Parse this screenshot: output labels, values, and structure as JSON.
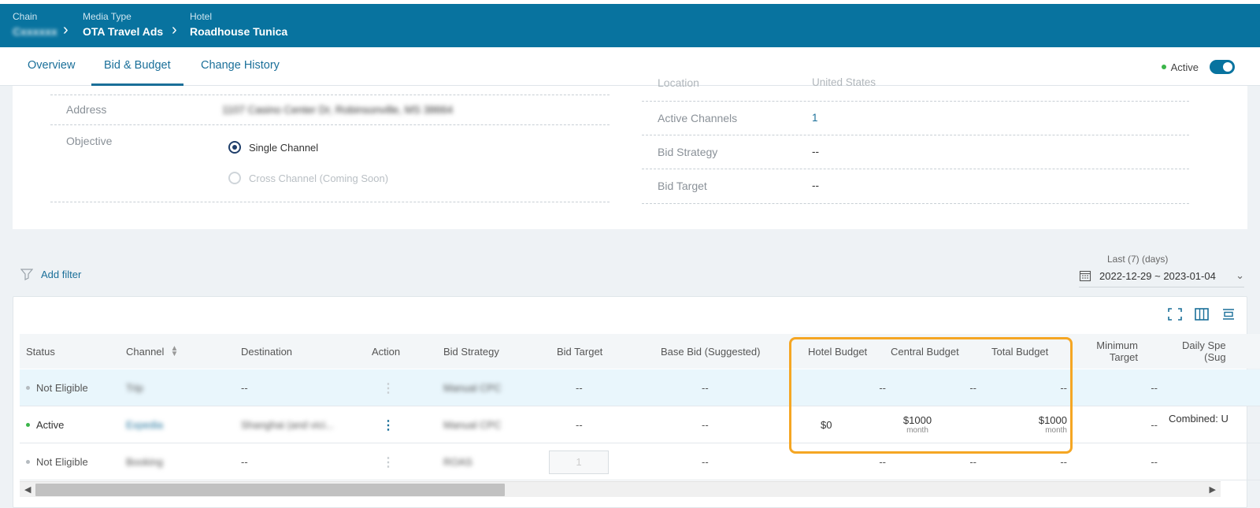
{
  "breadcrumb": {
    "chain": {
      "label": "Chain",
      "value": "Cxxxxxx"
    },
    "media_type": {
      "label": "Media Type",
      "value": "OTA Travel Ads"
    },
    "hotel": {
      "label": "Hotel",
      "value": "Roadhouse Tunica"
    }
  },
  "tabs": [
    {
      "label": "Overview",
      "active": false
    },
    {
      "label": "Bid & Budget",
      "active": true
    },
    {
      "label": "Change History",
      "active": false
    }
  ],
  "status_toggle": {
    "label": "Active",
    "on": true
  },
  "info": {
    "location": {
      "label": "Location",
      "value": "United States"
    },
    "address": {
      "label": "Address",
      "value": "1107 Casino Center Dr, Robinsonville, MS 38664"
    },
    "objective": {
      "label": "Objective",
      "options": [
        {
          "label": "Single Channel",
          "selected": true
        },
        {
          "label": "Cross Channel (Coming Soon)",
          "selected": false
        }
      ]
    },
    "active_channels": {
      "label": "Active Channels",
      "value": "1"
    },
    "bid_strategy": {
      "label": "Bid Strategy",
      "value": "--"
    },
    "bid_target": {
      "label": "Bid Target",
      "value": "--"
    }
  },
  "filter": {
    "add_label": "Add filter"
  },
  "date_range": {
    "caption": "Last (7) (days)",
    "value": "2022-12-29 ~ 2023-01-04"
  },
  "table": {
    "columns": {
      "status": "Status",
      "channel": "Channel",
      "destination": "Destination",
      "action": "Action",
      "bid_strategy": "Bid Strategy",
      "bid_target": "Bid Target",
      "base_bid": "Base Bid (Suggested)",
      "hotel_budget": "Hotel Budget",
      "central_budget": "Central Budget",
      "total_budget": "Total Budget",
      "minimum_target_1": "Minimum",
      "minimum_target_2": "Target",
      "daily_spend_1": "Daily Spe",
      "daily_spend_2": "(Sug"
    },
    "rows": [
      {
        "status": "Not Eligible",
        "status_color": "#b5bbc0",
        "channel": "Trip",
        "destination": "--",
        "bid_strategy": "Manual CPC",
        "bid_target": "--",
        "base_bid": "--",
        "hotel_budget": "--",
        "central_budget": "--",
        "total_budget": "--",
        "min_target": "--",
        "daily_spend": ""
      },
      {
        "status": "Active",
        "status_color": "#3bb54a",
        "channel": "Expedia",
        "destination": "Shanghai (and vici...",
        "bid_strategy": "Manual CPC",
        "bid_target": "--",
        "base_bid": "--",
        "hotel_budget": "$0",
        "central_budget": "$1000",
        "central_budget_unit": "month",
        "total_budget": "$1000",
        "total_budget_unit": "month",
        "min_target": "--",
        "daily_spend": "Combined: U"
      },
      {
        "status": "Not Eligible",
        "status_color": "#b5bbc0",
        "channel": "Booking",
        "destination": "--",
        "bid_strategy": "ROAS",
        "bid_target_input": "1",
        "base_bid": "--",
        "hotel_budget": "--",
        "central_budget": "--",
        "total_budget": "--",
        "min_target": "--",
        "daily_spend": ""
      }
    ]
  },
  "colors": {
    "brand": "#08739f",
    "highlight": "#f5a623",
    "active": "#3bb54a"
  }
}
